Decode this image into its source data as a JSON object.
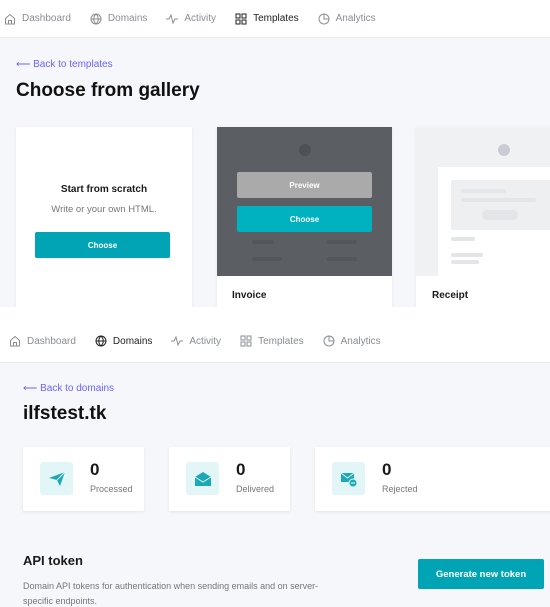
{
  "top": {
    "nav": [
      {
        "label": "Dashboard",
        "icon": "home-icon"
      },
      {
        "label": "Domains",
        "icon": "globe-icon"
      },
      {
        "label": "Activity",
        "icon": "activity-icon"
      },
      {
        "label": "Templates",
        "icon": "grid-icon",
        "active": true
      },
      {
        "label": "Analytics",
        "icon": "pie-icon"
      }
    ],
    "back": "⟵ Back to templates",
    "title": "Choose from gallery",
    "scratch": {
      "title": "Start from scratch",
      "subtitle": "Write or your own HTML.",
      "button": "Choose"
    },
    "invoice": {
      "title": "Invoice",
      "preview": "Preview",
      "choose": "Choose"
    },
    "receipt": {
      "title": "Receipt"
    }
  },
  "bottom": {
    "nav": [
      {
        "label": "Dashboard",
        "icon": "home-icon"
      },
      {
        "label": "Domains",
        "icon": "globe-icon",
        "active": true
      },
      {
        "label": "Activity",
        "icon": "activity-icon"
      },
      {
        "label": "Templates",
        "icon": "grid-icon"
      },
      {
        "label": "Analytics",
        "icon": "pie-icon"
      }
    ],
    "back": "⟵ Back to domains",
    "title": "ilfstest.tk",
    "stats": [
      {
        "value": "0",
        "label": "Processed",
        "icon": "paper-plane-icon"
      },
      {
        "value": "0",
        "label": "Delivered",
        "icon": "open-envelope-icon"
      },
      {
        "value": "0",
        "label": "Rejected",
        "icon": "mail-minus-icon"
      }
    ],
    "api": {
      "title": "API token",
      "description": "Domain API tokens for authentication when sending emails and on server-specific endpoints.",
      "button": "Generate new token"
    }
  },
  "colors": {
    "accent": "#00a4b4",
    "link": "#6c63ff",
    "background": "#f6f7fb"
  }
}
